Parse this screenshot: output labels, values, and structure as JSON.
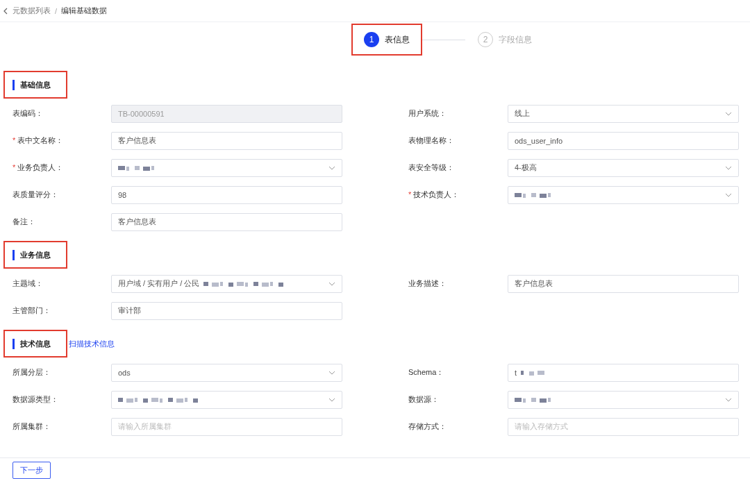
{
  "breadcrumb": {
    "items": [
      {
        "label": "元数据列表",
        "kind": "link"
      },
      {
        "label": "编辑基础数据",
        "kind": "current"
      }
    ],
    "separator": "/"
  },
  "steps": [
    {
      "number": "1",
      "label": "表信息",
      "selected": true,
      "highlighted": true
    },
    {
      "number": "2",
      "label": "字段信息",
      "selected": false,
      "highlighted": false
    }
  ],
  "sections": [
    {
      "title": "基础信息",
      "highlighted": true,
      "rows": [
        [
          {
            "label": "表编码：",
            "kind": "input",
            "value": "TB-00000591",
            "disabled": true,
            "redacted": false
          },
          {
            "label": "用户系统：",
            "kind": "select",
            "value": "线上",
            "disabled": false,
            "redacted": false
          }
        ],
        [
          {
            "label": "表中文名称：",
            "required_mark": "*",
            "kind": "input",
            "value": "客户信息表",
            "disabled": false,
            "redacted": false
          },
          {
            "label": "表物理名称：",
            "kind": "input",
            "value": "ods_user_info",
            "disabled": false,
            "redacted": false
          }
        ],
        [
          {
            "label": "业务负责人：",
            "required_mark": "*",
            "kind": "select",
            "disabled": false,
            "redacted": true
          },
          {
            "label": "表安全等级：",
            "kind": "select",
            "value": "4-极高",
            "disabled": false,
            "redacted": false
          }
        ],
        [
          {
            "label": "表质量评分：",
            "kind": "input",
            "value": "98",
            "disabled": false,
            "redacted": false
          },
          {
            "label": "技术负责人：",
            "required_mark": "*",
            "kind": "select",
            "disabled": false,
            "redacted": true
          }
        ],
        [
          {
            "label": "备注：",
            "kind": "input",
            "value": "客户信息表",
            "disabled": false,
            "redacted": false
          }
        ]
      ]
    },
    {
      "title": "业务信息",
      "highlighted": true,
      "rows": [
        [
          {
            "label": "主题域：",
            "kind": "select",
            "value": "用户域 / 实有用户 / 公民",
            "disabled": false,
            "redacted": true
          },
          {
            "label": "业务描述：",
            "kind": "input",
            "value": "客户信息表",
            "disabled": false,
            "redacted": false
          }
        ],
        [
          {
            "label": "主管部门：",
            "kind": "input",
            "value": "审计部",
            "disabled": false,
            "redacted": false
          }
        ]
      ]
    },
    {
      "title": "技术信息",
      "highlighted": true,
      "link": "扫描技术信息",
      "rows": [
        [
          {
            "label": "所属分层：",
            "kind": "select",
            "value": "ods",
            "disabled": false,
            "redacted": false
          },
          {
            "label": "Schema：",
            "kind": "input",
            "value": "t",
            "disabled": false,
            "redacted": true
          }
        ],
        [
          {
            "label": "数据源类型：",
            "kind": "select",
            "disabled": false,
            "redacted": true
          },
          {
            "label": "数据源：",
            "kind": "select",
            "disabled": false,
            "redacted": true
          }
        ],
        [
          {
            "label": "所属集群：",
            "kind": "input",
            "placeholder": "请输入所属集群",
            "disabled": false,
            "redacted": false
          },
          {
            "label": "存储方式：",
            "kind": "input",
            "placeholder": "请输入存储方式",
            "disabled": false,
            "redacted": false
          }
        ]
      ]
    }
  ],
  "footer": {
    "button": "下一步"
  }
}
